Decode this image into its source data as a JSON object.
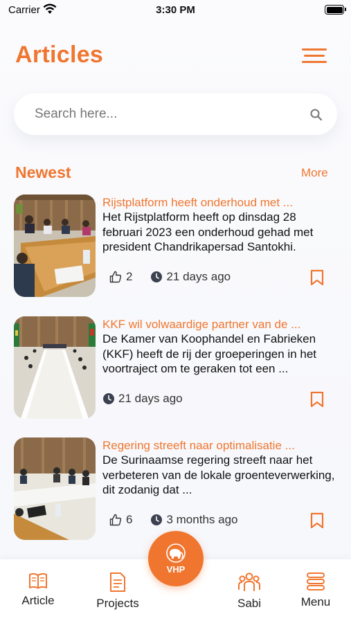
{
  "status_bar": {
    "carrier": "Carrier",
    "time": "3:30 PM"
  },
  "header": {
    "title": "Articles",
    "menu_icon": "hamburger-menu-icon"
  },
  "search": {
    "placeholder": "Search here...",
    "icon": "search-icon"
  },
  "section": {
    "title": "Newest",
    "more_label": "More"
  },
  "articles": [
    {
      "title": "Rijstplatform heeft onderhoud met ...",
      "summary": "Het Rijstplatform heeft op dinsdag 28 februari 2023 een onderhoud gehad met president Chandrikapersad Santokhi.",
      "likes": "2",
      "time": "21 days ago"
    },
    {
      "title": "KKF wil volwaardige partner van de ...",
      "summary": "De Kamer van Koophandel en Fabrieken (KKF) heeft de rij der groeperingen in het voortraject om te geraken tot een ...",
      "likes": "",
      "time": "21 days ago"
    },
    {
      "title": "Regering streeft naar optimalisatie ...",
      "summary": "De Surinaamse regering streeft naar het verbeteren van de lokale groenteverwerking, dit zodanig dat ...",
      "likes": "6",
      "time": "3 months ago"
    }
  ],
  "bottom_nav": {
    "items": [
      {
        "label": "Article",
        "icon": "book-icon"
      },
      {
        "label": "Projects",
        "icon": "document-icon"
      },
      {
        "label": "Sabi",
        "icon": "people-group-icon"
      },
      {
        "label": "Menu",
        "icon": "menu-lines-icon"
      }
    ],
    "center": {
      "label": "VHP",
      "icon": "elephant-icon"
    }
  },
  "colors": {
    "accent": "#f07630",
    "text": "#111111",
    "background": "#f7f8fc"
  }
}
